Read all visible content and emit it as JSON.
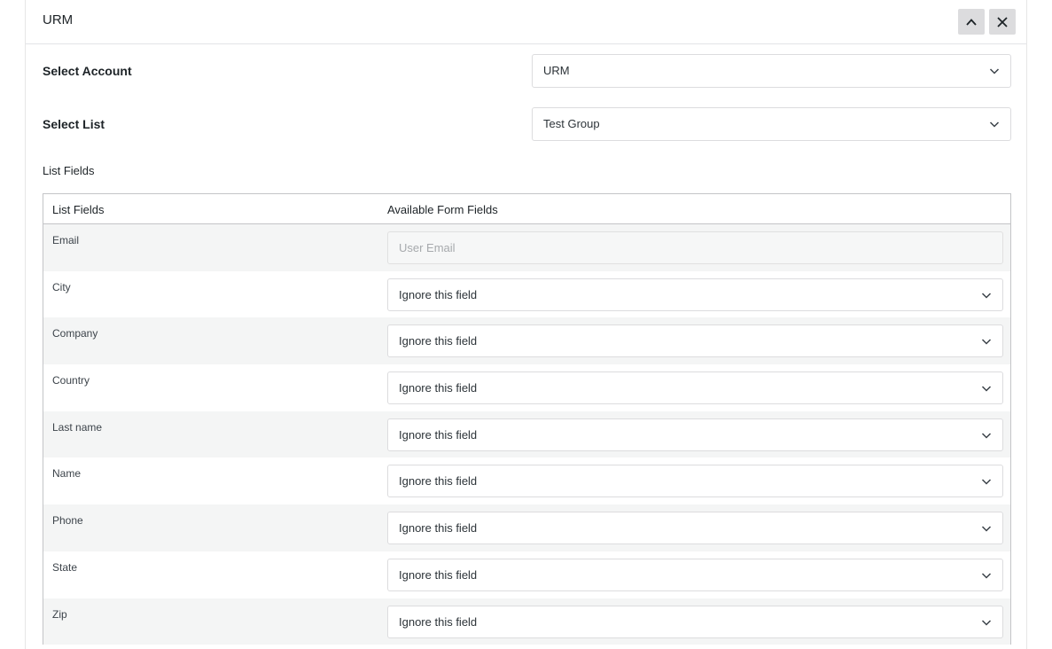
{
  "panel": {
    "title": "URM",
    "collapse_icon": "chevron-up-icon",
    "close_icon": "close-icon"
  },
  "account": {
    "label": "Select Account",
    "value": "URM"
  },
  "list": {
    "label": "Select List",
    "value": "Test Group"
  },
  "list_fields_section": {
    "label": "List Fields"
  },
  "table": {
    "col_list_fields": "List Fields",
    "col_form_fields": "Available Form Fields",
    "email_row": {
      "name": "Email",
      "placeholder": "User Email"
    },
    "rows": [
      {
        "name": "City",
        "value": "Ignore this field"
      },
      {
        "name": "Company",
        "value": "Ignore this field"
      },
      {
        "name": "Country",
        "value": "Ignore this field"
      },
      {
        "name": "Last name",
        "value": "Ignore this field"
      },
      {
        "name": "Name",
        "value": "Ignore this field"
      },
      {
        "name": "Phone",
        "value": "Ignore this field"
      },
      {
        "name": "State",
        "value": "Ignore this field"
      },
      {
        "name": "Zip",
        "value": "Ignore this field"
      }
    ]
  },
  "colors": {
    "header_button_bg": "#dcdcde",
    "alt_row_bg": "#f4f5f5",
    "border": "#c3c4c7"
  }
}
